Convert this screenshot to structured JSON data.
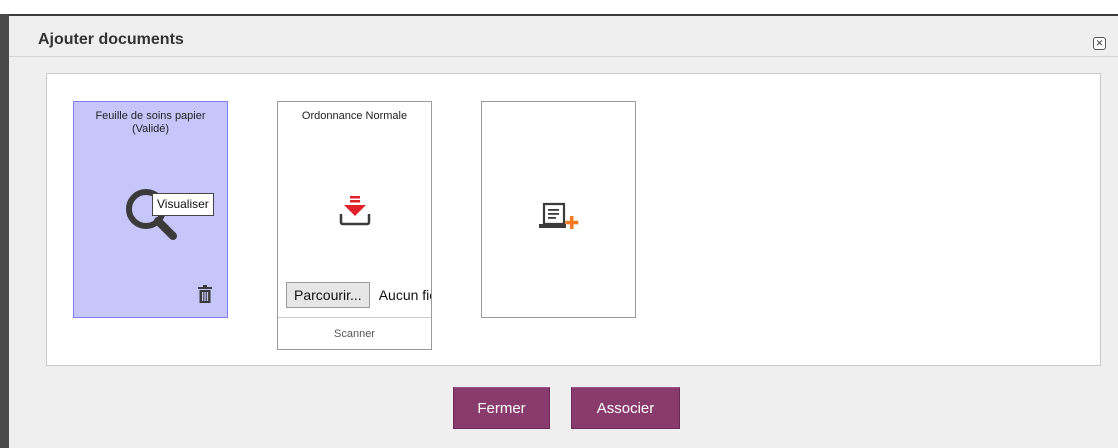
{
  "dialog": {
    "title": "Ajouter documents",
    "close_icon": "close-icon"
  },
  "cards": [
    {
      "title": "Feuille de soins papier",
      "subtitle": "(Validé)",
      "state": "selected",
      "icon": "magnifier-icon",
      "tooltip": "Visualiser",
      "action_icon": "trash-icon"
    },
    {
      "title": "Ordonnance Normale",
      "icon": "download-icon",
      "browse_label": "Parcourir...",
      "file_status": "Aucun fichier sélectionné.",
      "footer_label": "Scanner"
    },
    {
      "icon": "new-document-icon"
    }
  ],
  "buttons": {
    "close_label": "Fermer",
    "associate_label": "Associer"
  },
  "colors": {
    "selected_card_bg": "#c6c6fb",
    "selected_card_border": "#7e7ef0",
    "button_bg": "#8a3b6e",
    "download_accent": "#e0202a",
    "new_doc_accent": "#f47920"
  }
}
